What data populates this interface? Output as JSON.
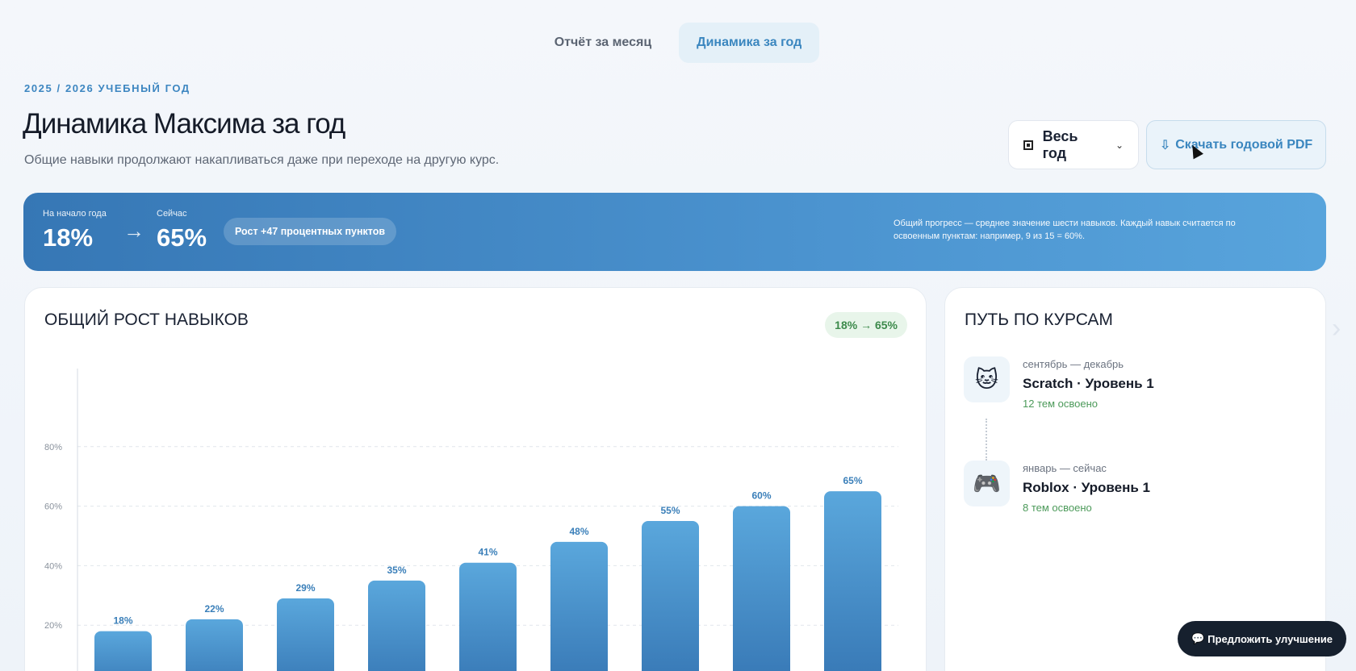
{
  "tabs": [
    {
      "label": "Отчёт за месяц",
      "active": false
    },
    {
      "label": "Динамика за год",
      "active": true
    }
  ],
  "header": {
    "eyebrow": "2025 / 2026 УЧЕБНЫЙ ГОД",
    "title": "Динамика Максима за год",
    "subtitle": "Общие навыки продолжают накапливаться даже при переходе на другую курс."
  },
  "controls": {
    "period_label": "Весь год",
    "period_icon": "stop-square-icon",
    "pdf_icon": "⇩",
    "pdf_label": "Скачать годовой PDF"
  },
  "banner": {
    "start_label": "На начало года",
    "start_value": "18%",
    "now_label": "Сейчас",
    "now_value": "65%",
    "growth": "Рост +47 процентных пунктов",
    "note": "Общий прогресс — среднее значение шести навыков. Каждый навык считается по освоенным пунктам: например, 9 из 15 = 60%."
  },
  "chart_card": {
    "title": "ОБЩИЙ РОСТ НАВЫКОВ",
    "chip": "18% → 65%"
  },
  "chart_data": {
    "type": "bar",
    "values": [
      18,
      22,
      29,
      35,
      41,
      48,
      55,
      60,
      65
    ],
    "data_labels": [
      "18%",
      "22%",
      "29%",
      "35%",
      "41%",
      "48%",
      "55%",
      "60%",
      "65%"
    ],
    "yticks": [
      {
        "value": 20,
        "label": "20%"
      },
      {
        "value": 40,
        "label": "40%"
      },
      {
        "value": 60,
        "label": "60%"
      },
      {
        "value": 80,
        "label": "80%"
      }
    ],
    "ylim": [
      0,
      100
    ],
    "grid": true,
    "color_top": "#5aa7dc",
    "color_bottom": "#3575b3",
    "label_color": "#3a7fb9"
  },
  "courses_card": {
    "title": "ПУТЬ ПО КУРСАМ",
    "items": [
      {
        "icon": "🐱",
        "icon_name": "cat-icon",
        "period": "сентябрь — декабрь",
        "name": "Scratch · Уровень 1",
        "count": "12 тем освоено"
      },
      {
        "icon": "🎮",
        "icon_name": "gamepad-icon",
        "period": "январь — сейчас",
        "name": "Roblox · Уровень 1",
        "count": "8 тем освоено"
      }
    ]
  },
  "side_arrow": "›",
  "feedback": {
    "icon": "💬",
    "label": "Предложить улучшение"
  }
}
